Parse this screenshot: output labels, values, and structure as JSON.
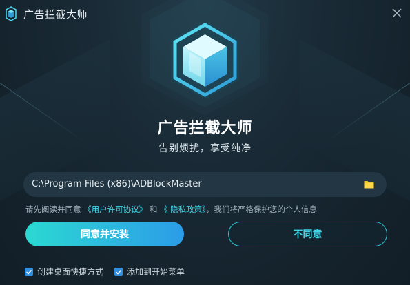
{
  "app": {
    "title": "广告拦截大师",
    "product_name": "广告拦截大师",
    "slogan": "告别烦扰，享受纯净"
  },
  "install": {
    "path": "C:\\Program Files (x86)\\ADBlockMaster"
  },
  "agreement": {
    "prefix": "请先阅读并同意",
    "license_link": "《用户许可协议》",
    "and": "和",
    "privacy_link": "《 隐私政策》",
    "suffix": "，我们将严格保护您的个人信息"
  },
  "buttons": {
    "agree_install": "同意并安装",
    "disagree": "不同意"
  },
  "options": [
    {
      "label": "创建桌面快捷方式",
      "checked": true
    },
    {
      "label": "添加到开始菜单",
      "checked": true
    }
  ],
  "colors": {
    "accent_cyan": "#3fd4e6",
    "button_gradient_start": "#2bd9d2",
    "button_gradient_end": "#2c9ce8",
    "checkbox_blue": "#2f8fe0",
    "folder_yellow": "#f5c431",
    "background": "#182a35"
  },
  "icons": {
    "app": "shield-cube-icon",
    "close": "close-icon",
    "folder": "folder-icon",
    "checkbox": "checkmark-icon"
  }
}
